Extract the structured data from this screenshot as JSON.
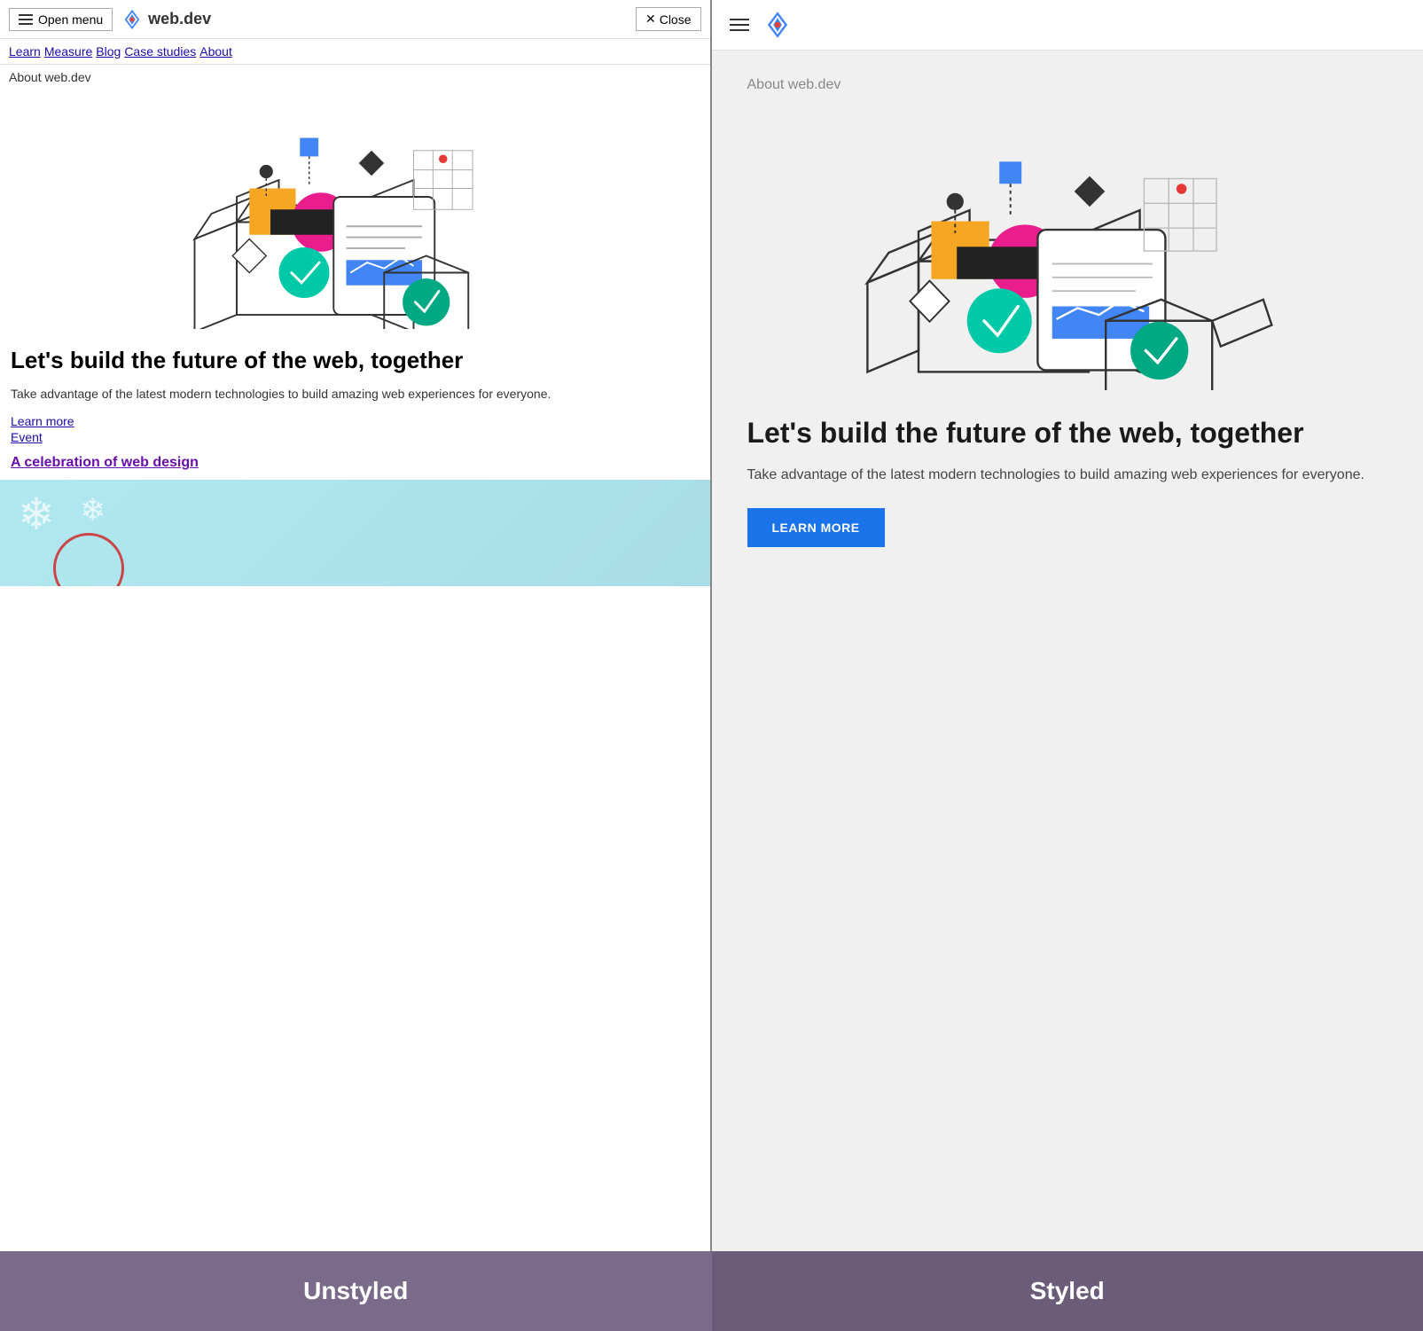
{
  "left": {
    "navbar": {
      "menu_btn": "Open menu",
      "site_name": "web.dev",
      "close_btn": "Close"
    },
    "nav_links": [
      "Learn",
      "Measure",
      "Blog",
      "Case studies",
      "About"
    ],
    "about_text": "About web.dev",
    "heading": "Let's build the future of the web, together",
    "description": "Take advantage of the latest modern technologies to build amazing web experiences for everyone.",
    "links": [
      "Learn more",
      "Event"
    ],
    "event_link": "A celebration of web design"
  },
  "right": {
    "about_text": "About web.dev",
    "heading": "Let's build the future of the web, together",
    "description": "Take advantage of the latest modern technologies to build amazing web experiences for everyone.",
    "learn_more_btn": "LEARN MORE"
  },
  "labels": {
    "unstyled": "Unstyled",
    "styled": "Styled"
  }
}
